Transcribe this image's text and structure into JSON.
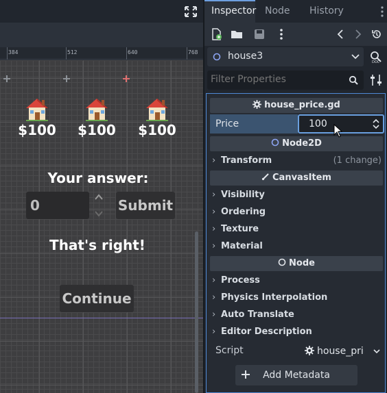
{
  "viewport": {
    "ruler_ticks": [
      "384",
      "512",
      "640",
      "768"
    ],
    "houses": [
      {
        "price": "$100",
        "icon": "house-icon"
      },
      {
        "price": "$100",
        "icon": "house-icon"
      },
      {
        "price": "$100",
        "icon": "house-icon"
      }
    ],
    "answer_label": "Your answer:",
    "answer_value": "0",
    "submit_label": "Submit",
    "result_text": "That's right!",
    "continue_label": "Continue"
  },
  "inspector": {
    "tabs": [
      "Inspector",
      "Node",
      "History"
    ],
    "active_tab": "Inspector",
    "node_name": "house3",
    "filter_placeholder": "Filter Properties",
    "script_section": "house_price.gd",
    "price_label": "Price",
    "price_value": "100",
    "node2d_section": "Node2D",
    "transform_label": "Transform",
    "transform_note": "(1 change)",
    "canvasitem_section": "CanvasItem",
    "canvasitem_groups": [
      "Visibility",
      "Ordering",
      "Texture",
      "Material"
    ],
    "node_section": "Node",
    "node_groups": [
      "Process",
      "Physics Interpolation",
      "Auto Translate",
      "Editor Description"
    ],
    "script_label": "Script",
    "script_value": "house_pri",
    "add_metadata_label": "Add Metadata"
  },
  "colors": {
    "accent": "#6aa0e0",
    "selected_row": "#3b5470",
    "canvas_bg": "#3e3e40"
  }
}
